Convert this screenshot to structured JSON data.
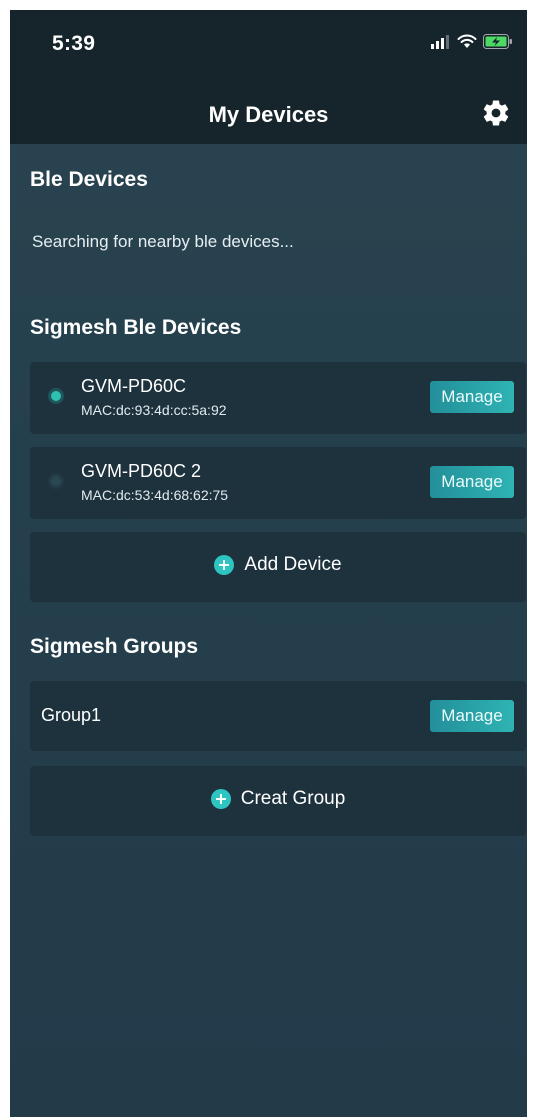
{
  "status_bar": {
    "time": "5:39",
    "icons": [
      "cellular-signal-icon",
      "wifi-icon",
      "battery-charging-icon"
    ]
  },
  "nav": {
    "title": "My Devices",
    "settings_icon": "gear-icon"
  },
  "ble_section": {
    "title": "Ble Devices",
    "status_text": "Searching for nearby ble devices..."
  },
  "sigmesh_devices": {
    "title": "Sigmesh Ble Devices",
    "devices": [
      {
        "name": "GVM-PD60C",
        "mac": "MAC:dc:93:4d:cc:5a:92",
        "selected": true,
        "manage_label": "Manage"
      },
      {
        "name": "GVM-PD60C 2",
        "mac": "MAC:dc:53:4d:68:62:75",
        "selected": false,
        "manage_label": "Manage"
      }
    ],
    "add_label": "Add Device"
  },
  "sigmesh_groups": {
    "title": "Sigmesh Groups",
    "groups": [
      {
        "name": "Group1",
        "manage_label": "Manage"
      }
    ],
    "create_label": "Creat Group"
  },
  "colors": {
    "background": "#25404d",
    "header": "#16252c",
    "card": "#1d323d",
    "accent": "#2fb3b3"
  }
}
